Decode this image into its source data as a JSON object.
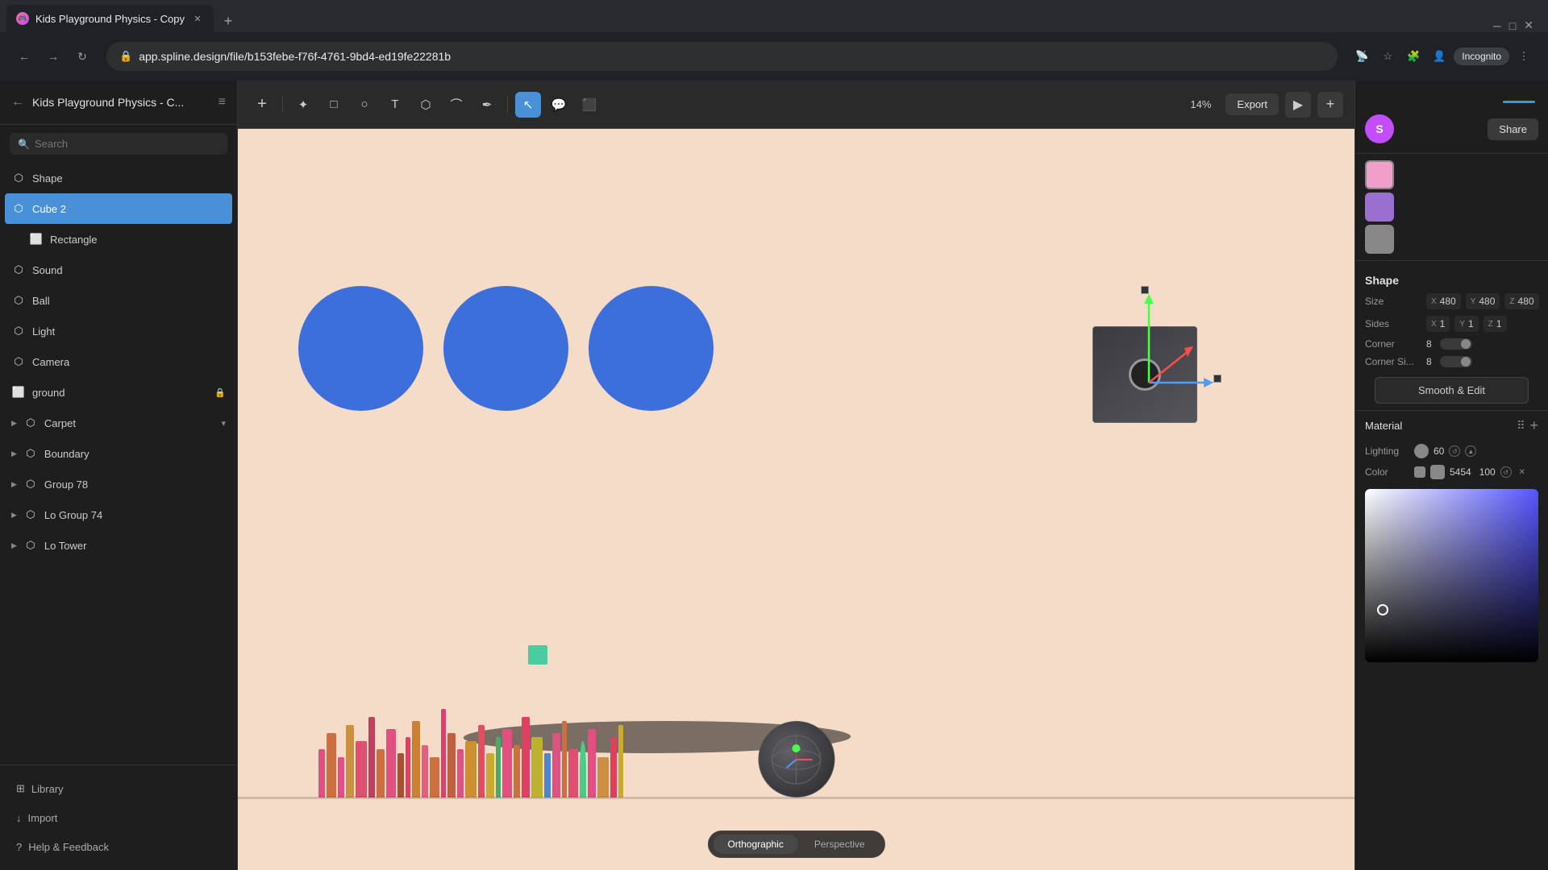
{
  "browser": {
    "tab_title": "Kids Playground Physics - Copy",
    "tab_favicon": "🎮",
    "address": "app.spline.design/file/b153febe-f76f-4761-9bd4-ed19fe22281b",
    "new_tab_label": "+",
    "nav_back": "←",
    "nav_forward": "→",
    "nav_refresh": "↻",
    "incognito_label": "Incognito",
    "minimize": "─",
    "maximize": "□",
    "close": "✕"
  },
  "sidebar": {
    "title": "Kids Playground Physics - C...",
    "back_icon": "←",
    "menu_icon": "≡",
    "search_placeholder": "Search",
    "items": [
      {
        "id": "shape",
        "label": "Shape",
        "icon": "⬡",
        "indent": 0,
        "active": false
      },
      {
        "id": "cube2",
        "label": "Cube 2",
        "icon": "⬡",
        "indent": 0,
        "active": true
      },
      {
        "id": "rectangle",
        "label": "Rectangle",
        "icon": "⬜",
        "indent": 1,
        "active": false
      },
      {
        "id": "sound",
        "label": "Sound",
        "icon": "⬡",
        "indent": 0,
        "active": false
      },
      {
        "id": "ball",
        "label": "Ball",
        "icon": "⬡",
        "indent": 0,
        "active": false
      },
      {
        "id": "light",
        "label": "Light",
        "icon": "⬡",
        "indent": 0,
        "active": false
      },
      {
        "id": "camera",
        "label": "Camera",
        "icon": "⬡",
        "indent": 0,
        "active": false
      },
      {
        "id": "ground",
        "label": "ground",
        "icon": "⬜",
        "indent": 0,
        "active": false,
        "lock": true
      },
      {
        "id": "carpet",
        "label": "Carpet",
        "icon": "⬡",
        "indent": 0,
        "active": false,
        "has_arrow": true,
        "arrow_down": true
      },
      {
        "id": "boundary",
        "label": "Boundary",
        "icon": "⬡",
        "indent": 0,
        "active": false,
        "has_arrow": true
      },
      {
        "id": "group78",
        "label": "Group 78",
        "icon": "⬡",
        "indent": 0,
        "active": false,
        "has_arrow": true
      },
      {
        "id": "group74",
        "label": "Lo Group 74",
        "icon": "⬡",
        "indent": 0,
        "active": false,
        "has_arrow": true
      },
      {
        "id": "tower",
        "label": "Lo Tower",
        "icon": "⬡",
        "indent": 0,
        "active": false,
        "has_arrow": true
      }
    ],
    "footer": [
      {
        "id": "library",
        "label": "Library",
        "icon": "⊞"
      },
      {
        "id": "import",
        "label": "Import",
        "icon": "↓"
      },
      {
        "id": "help",
        "label": "Help & Feedback",
        "icon": "?"
      }
    ]
  },
  "toolbar": {
    "add_icon": "+",
    "cursor_tool": "↖",
    "rect_tool": "□",
    "circle_tool": "○",
    "text_tool": "T",
    "shape3d_tool": "⬡",
    "path_tool": "⌇",
    "pen_tool": "✒",
    "select_tool": "↖",
    "comment_tool": "💬",
    "screen_tool": "⬜",
    "zoom_level": "14%",
    "export_label": "Export",
    "play_icon": "▶",
    "add_scene_icon": "+"
  },
  "right_panel": {
    "user_initial": "S",
    "share_label": "Share",
    "section_shape": "Shape",
    "size_label": "Size",
    "size_x": "480",
    "size_y": "480",
    "size_z": "480",
    "sides_label": "Sides",
    "sides_x": "1",
    "sides_y": "1",
    "sides_z": "1",
    "corner_label": "Corner",
    "corner_value": "8",
    "corner_size_label": "Corner Si...",
    "corner_size_value": "8",
    "smooth_edit_label": "Smooth & Edit",
    "material_label": "Material",
    "lighting_label": "Lighting",
    "lighting_value": "60",
    "color_label": "Color",
    "color_hex": "5454",
    "color_opacity": "100"
  },
  "canvas": {
    "view_mode_ortho": "Orthographic",
    "view_mode_persp": "Perspective"
  }
}
